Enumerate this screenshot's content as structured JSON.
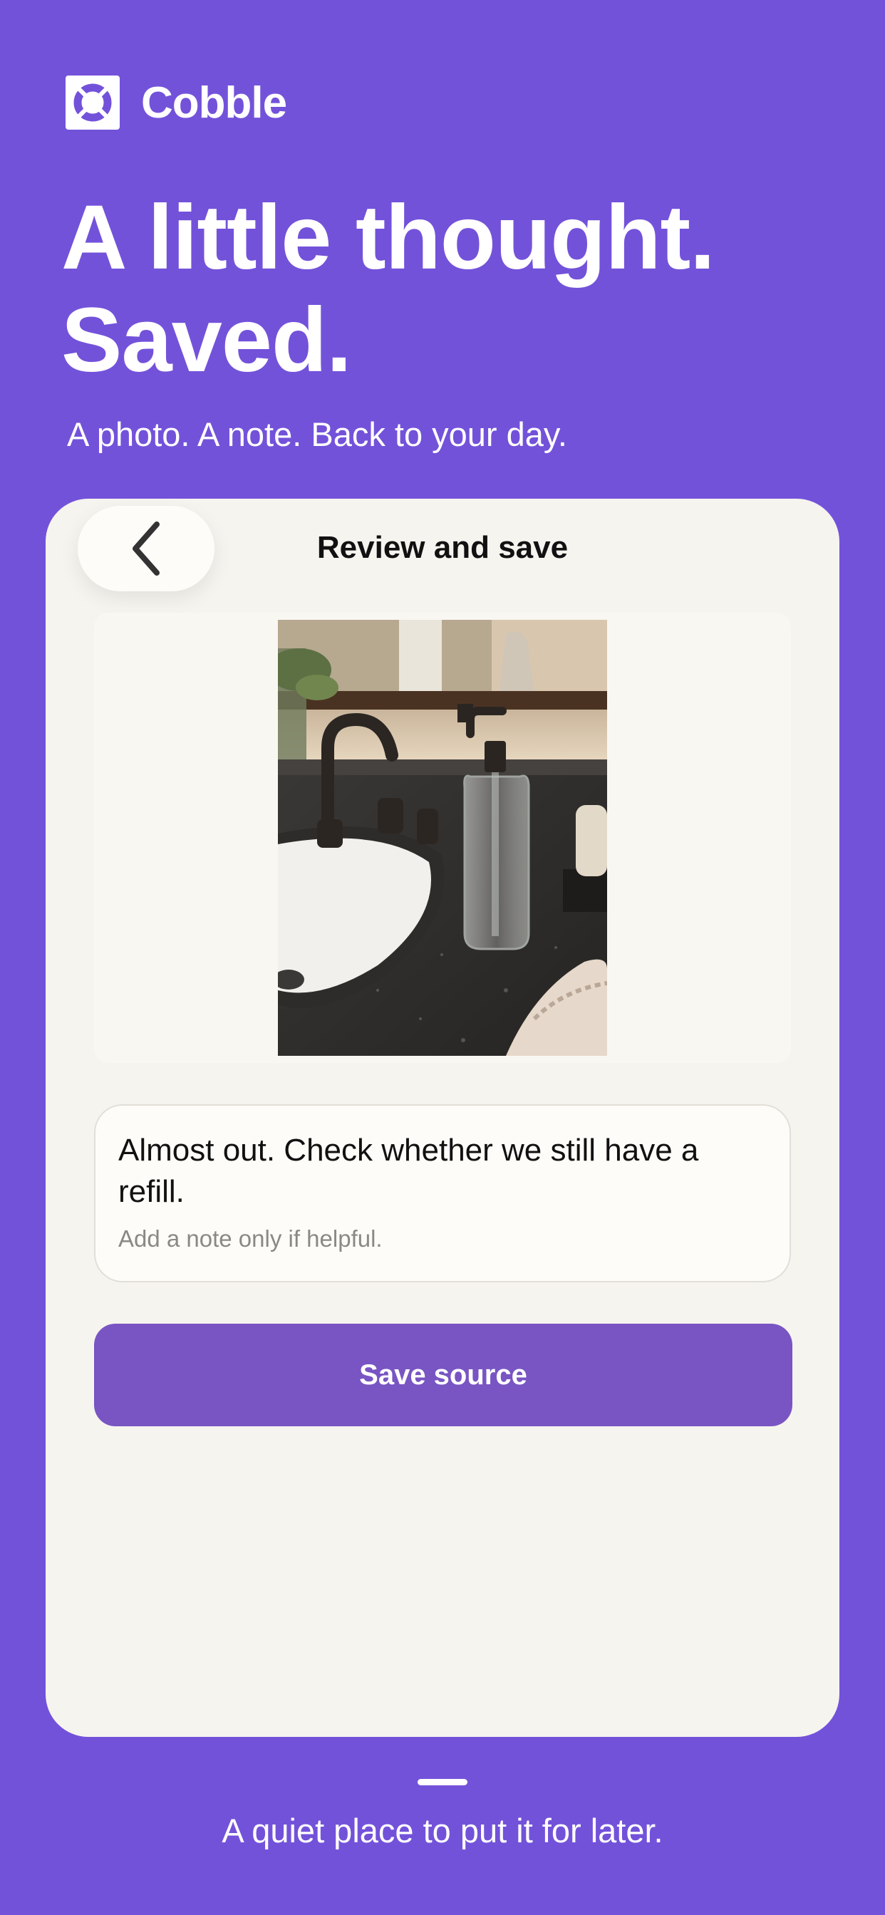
{
  "brand": {
    "name": "Cobble",
    "logo_icon": "cobble-logo-icon"
  },
  "hero": {
    "headline_line1": "A little thought.",
    "headline_line2": "Saved.",
    "subheadline": "A photo. A note. Back to your day."
  },
  "screen": {
    "title": "Review and save",
    "back_icon": "chevron-left-icon",
    "photo_description_icon": "photo-bathroom-soap-dispenser",
    "note": {
      "value": "Almost out. Check whether we still have a refill.",
      "placeholder": "Add a note only if helpful."
    },
    "save_button_label": "Save source"
  },
  "footer": {
    "caption": "A quiet place to put it for later."
  },
  "colors": {
    "background": "#7352DA",
    "card": "#F6F4EF",
    "button": "#7855C3",
    "text": "#111111"
  }
}
